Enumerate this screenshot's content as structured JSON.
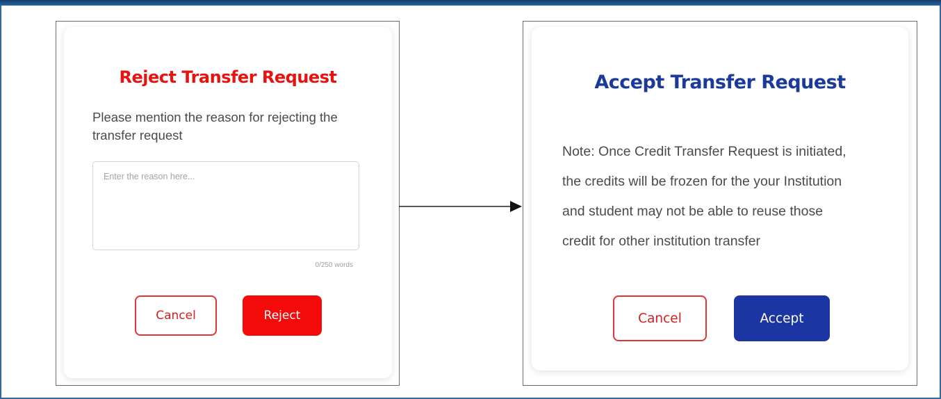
{
  "reject_dialog": {
    "title": "Reject Transfer Request",
    "description": "Please mention the reason for rejecting the transfer request",
    "reason_placeholder": "Enter the reason here...",
    "reason_value": "",
    "word_count": "0/250 words",
    "cancel_label": "Cancel",
    "reject_label": "Reject"
  },
  "accept_dialog": {
    "title": "Accept Transfer Request",
    "note_lines": [
      "Note: Once Credit Transfer Request is initiated,",
      "the credits will be frozen for the your Institution",
      "and student may not be able to reuse those",
      "credit for other institution transfer"
    ],
    "cancel_label": "Cancel",
    "accept_label": "Accept"
  },
  "colors": {
    "reject_red": "#f50a0a",
    "accept_blue": "#1b36a3",
    "frame_blue": "#1f4f86"
  },
  "flow_arrow": "arrow-right-icon"
}
